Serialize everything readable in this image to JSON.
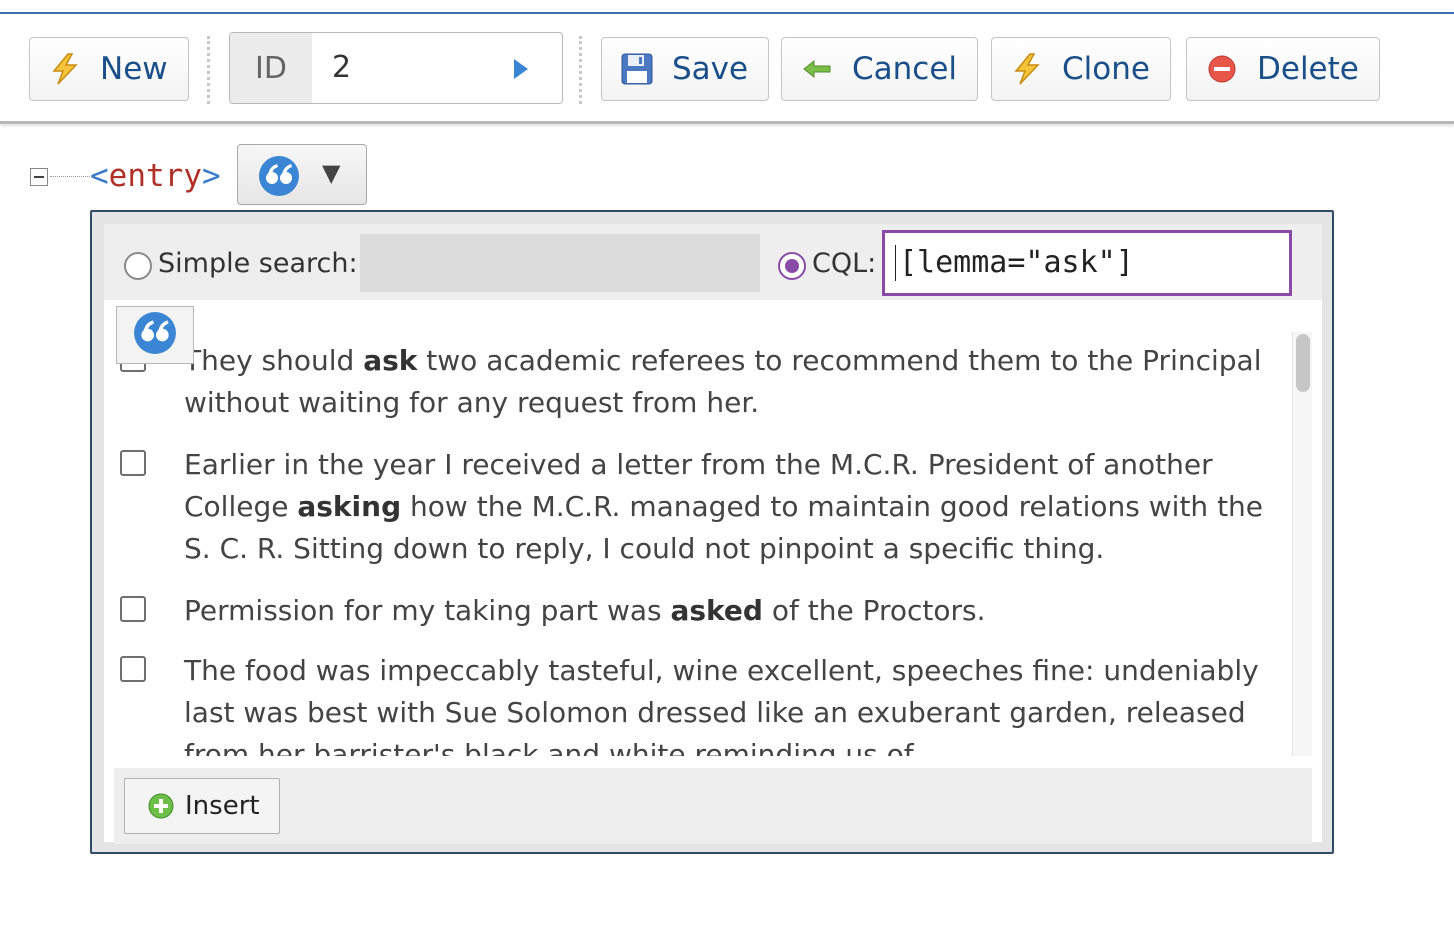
{
  "toolbar": {
    "new_label": "New",
    "id_label": "ID",
    "id_value": "2",
    "save_label": "Save",
    "cancel_label": "Cancel",
    "clone_label": "Clone",
    "delete_label": "Delete"
  },
  "tree": {
    "tag_open": "<",
    "tag_name": "entry",
    "tag_close": ">",
    "dropdown_caret": "▼"
  },
  "search": {
    "simple_label": "Simple search:",
    "simple_value": "",
    "cql_label": "CQL:",
    "cql_value": "[lemma=\"ask\"]",
    "selected_mode": "CQL"
  },
  "results": [
    {
      "before": "They should ",
      "keyword": "ask",
      "after": " two academic referees to recommend them to the Principal without waiting for any request from her.",
      "checked": false
    },
    {
      "before": "Earlier in the year I received a letter from the M.C.R. President of another College ",
      "keyword": "asking",
      "after": " how the M.C.R. managed to maintain good relations with the S. C. R. Sitting down to reply, I could not pinpoint a specific thing.",
      "checked": false
    },
    {
      "before": "Permission for my taking part was ",
      "keyword": "asked",
      "after": " of the Proctors.",
      "checked": false
    },
    {
      "before": "The food was impeccably tasteful, wine excellent, speeches fine: undeniably last was best with Sue Solomon dressed like an exuberant garden, released from her barrister's black and white reminding us of",
      "keyword": "",
      "after": "",
      "checked": false
    }
  ],
  "footer": {
    "insert_label": "Insert"
  },
  "colors": {
    "accent_purple": "#8a4aa8",
    "link_blue": "#1a4f8a",
    "panel_border": "#2f4b67"
  }
}
